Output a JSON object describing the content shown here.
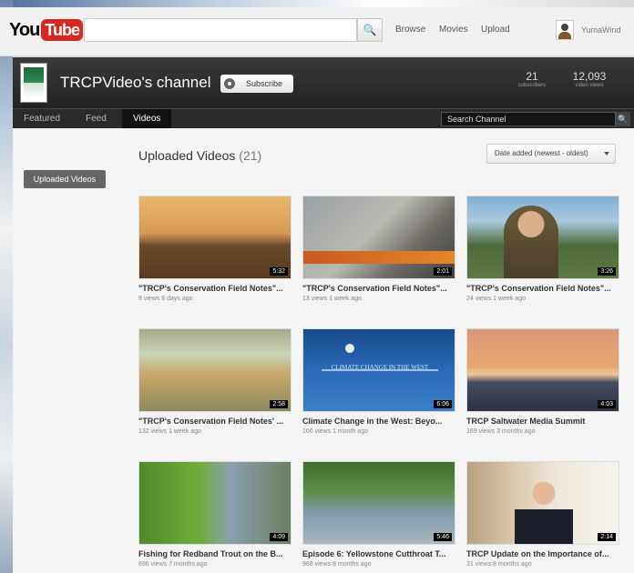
{
  "masthead": {
    "logo_you": "You",
    "logo_tube": "Tube",
    "search_placeholder": "",
    "search_button_glyph": "🔍",
    "links": [
      "Browse",
      "Movies",
      "Upload"
    ],
    "username": "YumaWind"
  },
  "channel": {
    "title": "TRCPVideo's channel",
    "subscribe_label": "Subscribe",
    "stats": [
      {
        "value": "21",
        "label": "subscribers"
      },
      {
        "value": "12,093",
        "label": "video views"
      }
    ]
  },
  "nav": {
    "tabs": [
      "Featured",
      "Feed",
      "Videos"
    ],
    "active_tab": "Videos",
    "search_placeholder": "Search Channel",
    "search_button_glyph": "🔍"
  },
  "content": {
    "side_label": "Uploaded Videos",
    "section_title": "Uploaded Videos",
    "section_count": "(21)",
    "sort_label": "Date added (newest - oldest)"
  },
  "videos": [
    {
      "title": "\"TRCP's Conservation Field Notes\"...",
      "meta": "9 views 6 days ago",
      "duration": "5:32"
    },
    {
      "title": "\"TRCP's Conservation Field Notes\"...",
      "meta": "13 views 1 week ago",
      "duration": "2:01"
    },
    {
      "title": "\"TRCP's Conservation Field Notes\"...",
      "meta": "24 views 1 week ago",
      "duration": "3:26"
    },
    {
      "title": "\"TRCP's Conservation Field Notes' ...",
      "meta": "132 views 1 week ago",
      "duration": "2:58"
    },
    {
      "title": "Climate Change in the West: Beyo...",
      "meta": "166 views 1 month ago",
      "duration": "6:06"
    },
    {
      "title": "TRCP Saltwater Media Summit",
      "meta": "169 views 3 months ago",
      "duration": "4:03"
    },
    {
      "title": "Fishing for Redband Trout on the B...",
      "meta": "696 views 7 months ago",
      "duration": "4:09"
    },
    {
      "title": "Episode 6: Yellowstone Cutthroat T...",
      "meta": "968 views 8 months ago",
      "duration": "5:46"
    },
    {
      "title": "TRCP Update on the Importance of...",
      "meta": "31 views 8 months ago",
      "duration": "2:14"
    }
  ],
  "thumbnail_texts": {
    "climate_change": "CLIMATE CHANGE IN THE WEST"
  }
}
